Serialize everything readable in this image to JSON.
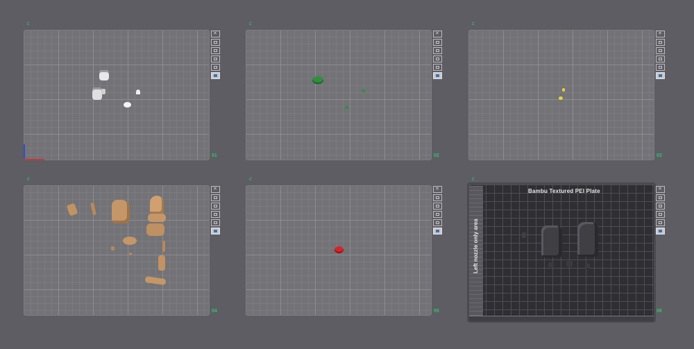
{
  "plates": [
    {
      "number": "01",
      "corner_label": "c"
    },
    {
      "number": "02",
      "corner_label": "c"
    },
    {
      "number": "03",
      "corner_label": "c"
    },
    {
      "number": "04",
      "corner_label": "c"
    },
    {
      "number": "05",
      "corner_label": "c"
    },
    {
      "number": "06",
      "corner_label": "c"
    }
  ],
  "plate6": {
    "title": "Bambu Textured PEI Plate",
    "side_label": "Left nozzle only area"
  },
  "toolbar_icons": [
    "close-icon",
    "arrange-icon",
    "orient-icon",
    "lock-icon",
    "settings-icon",
    "edit-icon"
  ],
  "colors": {
    "background": "#5d5d63",
    "plate": "#727277",
    "plate_dark": "#2f2f33",
    "accent_green": "#32c46a",
    "active_blue": "#3c6fb5"
  }
}
